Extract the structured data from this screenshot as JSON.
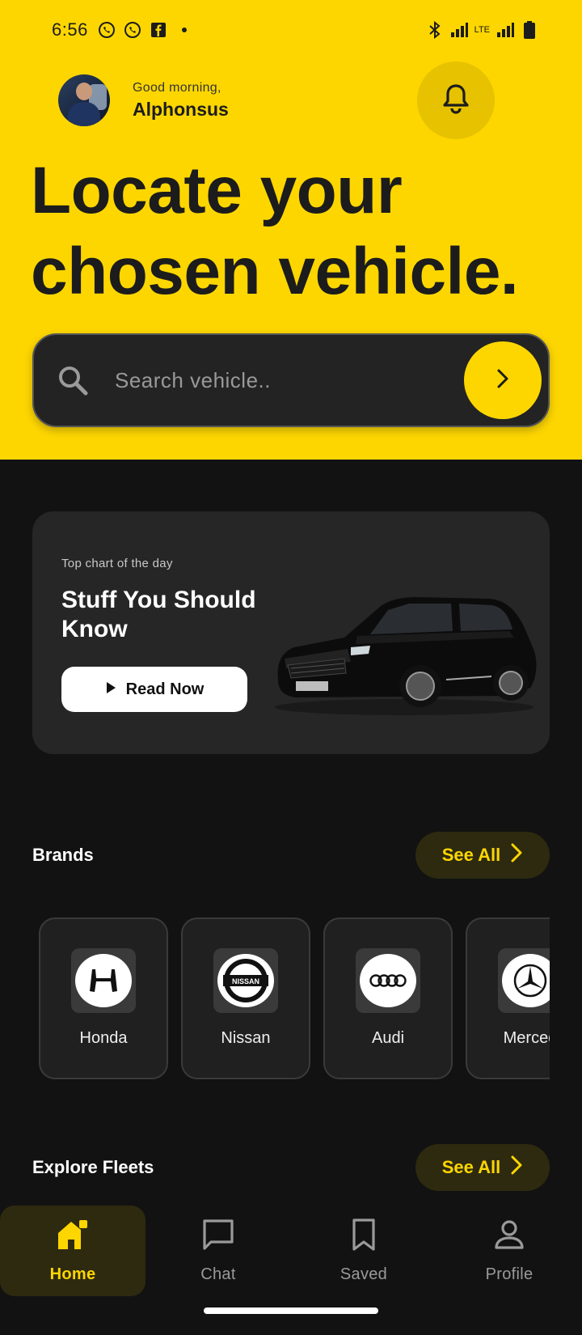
{
  "status_bar": {
    "time": "6:56",
    "left_icons": [
      "whatsapp-icon",
      "whatsapp-icon",
      "facebook-icon",
      "dot-icon"
    ],
    "right_icons": [
      "bluetooth-icon",
      "signal-icon",
      "lte-signal-icon",
      "battery-icon"
    ],
    "network_label": "LTE"
  },
  "header": {
    "greeting": "Good morning,",
    "user_name": "Alphonsus",
    "headline_line1": "Locate your",
    "headline_line2": "chosen vehicle."
  },
  "search": {
    "placeholder": "Search vehicle..",
    "value": ""
  },
  "promo": {
    "kicker": "Top chart of the day",
    "title": "Stuff You Should Know",
    "button_label": "Read Now"
  },
  "brands_section": {
    "title": "Brands",
    "see_all_label": "See All",
    "items": [
      {
        "name": "Honda",
        "logo": "honda-logo"
      },
      {
        "name": "Nissan",
        "logo": "nissan-logo"
      },
      {
        "name": "Audi",
        "logo": "audi-logo"
      },
      {
        "name": "Merced",
        "logo": "mercedes-logo"
      }
    ]
  },
  "fleets_section": {
    "title": "Explore Fleets",
    "see_all_label": "See All"
  },
  "bottom_nav": {
    "items": [
      {
        "label": "Home",
        "icon": "home-icon",
        "active": true
      },
      {
        "label": "Chat",
        "icon": "chat-icon",
        "active": false
      },
      {
        "label": "Saved",
        "icon": "bookmark-icon",
        "active": false
      },
      {
        "label": "Profile",
        "icon": "profile-icon",
        "active": false
      }
    ]
  },
  "colors": {
    "accent": "#FDD600",
    "background": "#121212",
    "card": "#262626",
    "text_dark": "#1C1C1C"
  }
}
